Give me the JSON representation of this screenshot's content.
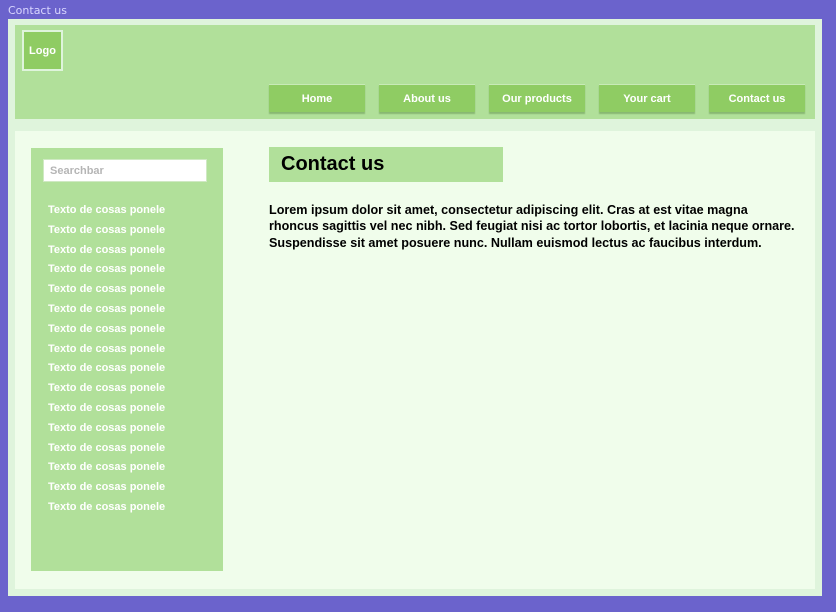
{
  "frame": {
    "title": "Contact us"
  },
  "header": {
    "logo_label": "Logo",
    "nav": [
      {
        "label": "Home"
      },
      {
        "label": "About us"
      },
      {
        "label": "Our products"
      },
      {
        "label": "Your cart"
      },
      {
        "label": "Contact us"
      }
    ]
  },
  "sidebar": {
    "search_placeholder": "Searchbar",
    "items": [
      {
        "label": "Texto de cosas ponele"
      },
      {
        "label": "Texto de cosas ponele"
      },
      {
        "label": "Texto de cosas ponele"
      },
      {
        "label": "Texto de cosas ponele"
      },
      {
        "label": "Texto de cosas ponele"
      },
      {
        "label": "Texto de cosas ponele"
      },
      {
        "label": "Texto de cosas ponele"
      },
      {
        "label": "Texto de cosas ponele"
      },
      {
        "label": "Texto de cosas ponele"
      },
      {
        "label": "Texto de cosas ponele"
      },
      {
        "label": "Texto de cosas ponele"
      },
      {
        "label": "Texto de cosas ponele"
      },
      {
        "label": "Texto de cosas ponele"
      },
      {
        "label": "Texto de cosas ponele"
      },
      {
        "label": "Texto de cosas ponele"
      },
      {
        "label": "Texto de cosas ponele"
      }
    ]
  },
  "main": {
    "title": "Contact us",
    "body": "Lorem ipsum dolor sit amet, consectetur adipiscing elit. Cras at est vitae magna rhoncus sagittis vel nec nibh. Sed feugiat nisi ac tortor lobortis, et lacinia neque ornare. Suspendisse sit amet posuere nunc. Nullam euismod lectus ac faucibus interdum."
  },
  "colors": {
    "frame_bg": "#6b63cc",
    "page_bg": "#dff4dc",
    "header_bg": "#b1e09a",
    "button_bg": "#8fcc63",
    "content_bg": "#f0fdeb"
  }
}
